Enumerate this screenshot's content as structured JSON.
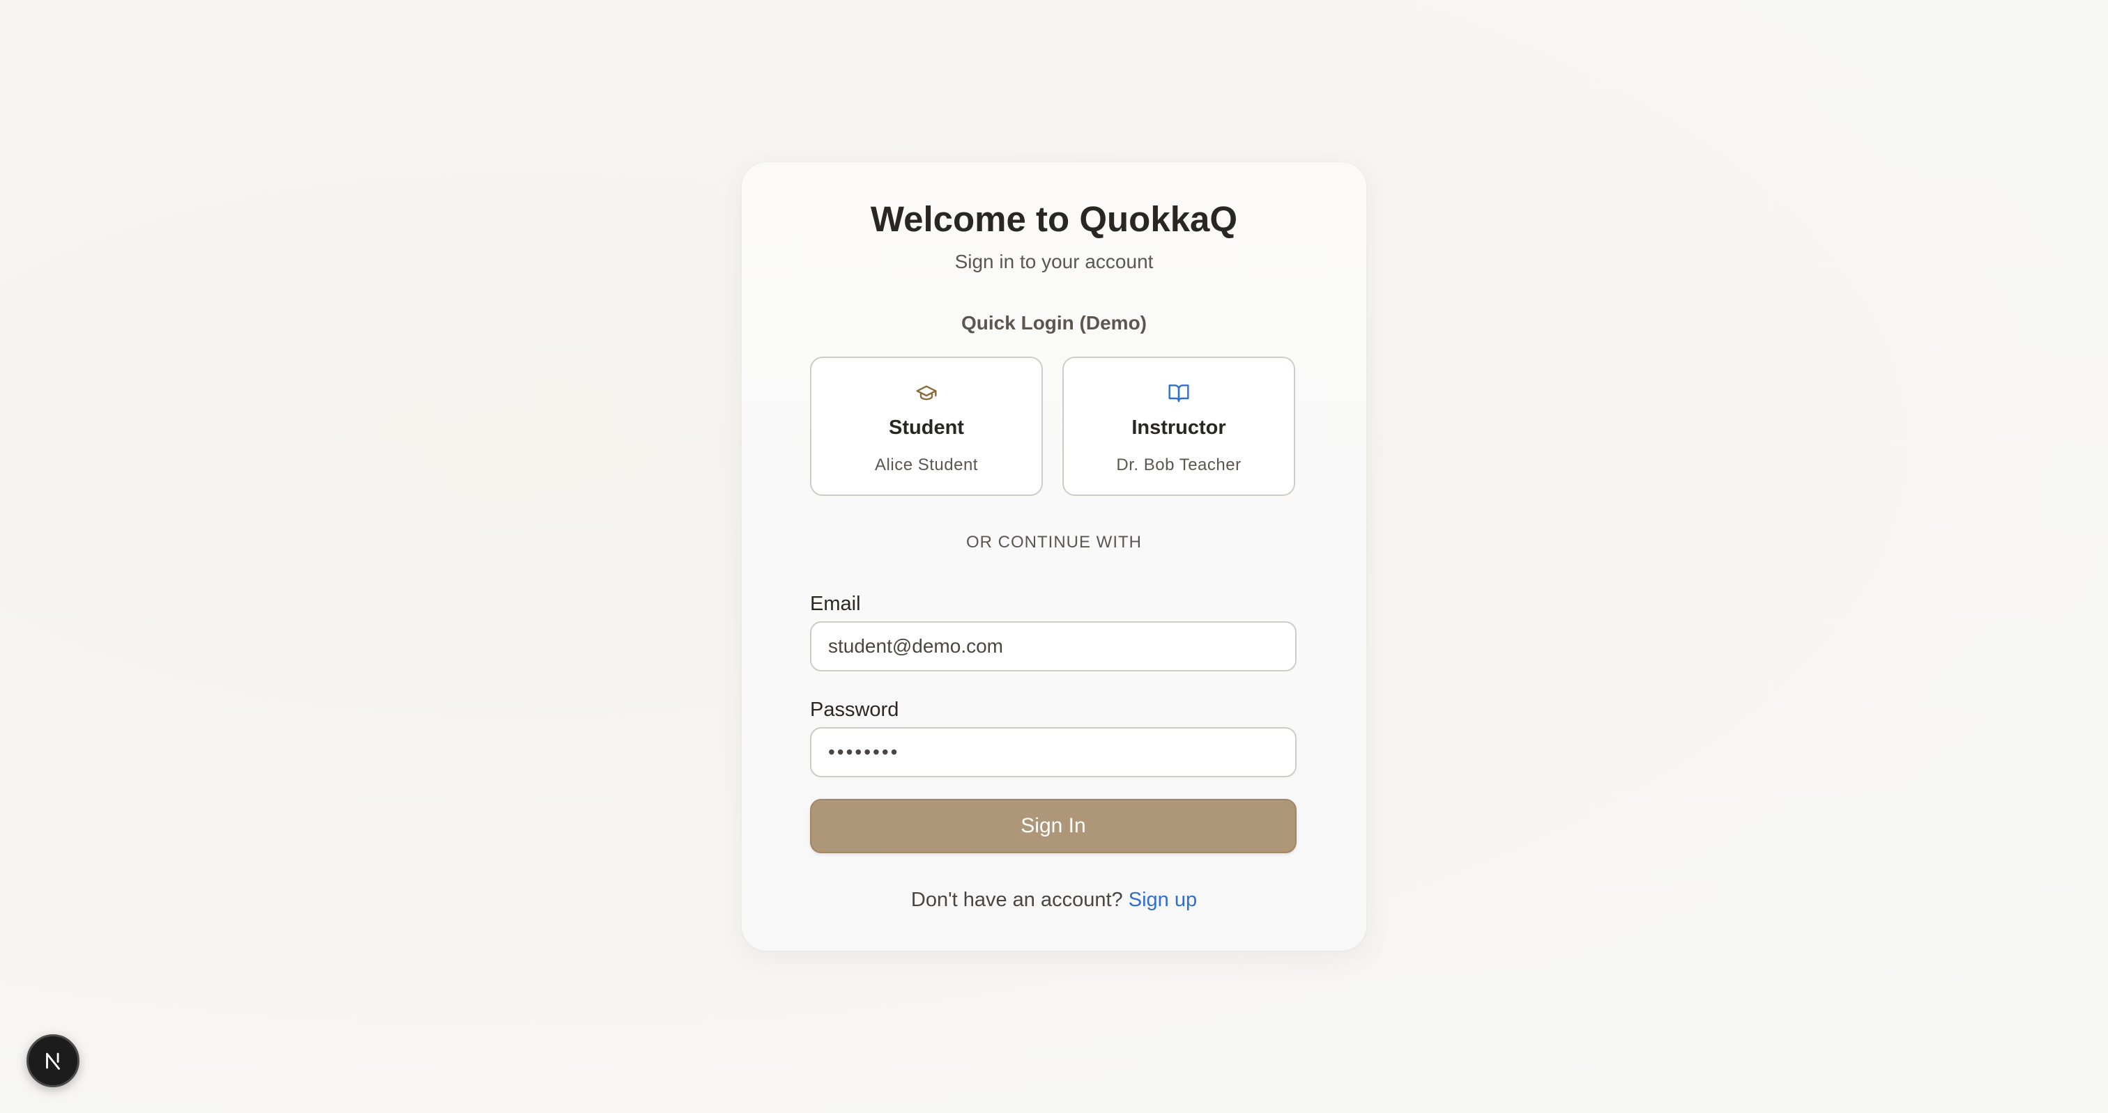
{
  "login": {
    "title": "Welcome to QuokkaQ",
    "subtitle": "Sign in to your account",
    "quick_login_heading": "Quick Login (Demo)",
    "roles": [
      {
        "title": "Student",
        "name": "Alice Student",
        "icon": "graduation-cap-icon",
        "icon_color": "#8b6b3d"
      },
      {
        "title": "Instructor",
        "name": "Dr. Bob Teacher",
        "icon": "open-book-icon",
        "icon_color": "#2f6fd0"
      }
    ],
    "divider_text": "OR CONTINUE WITH",
    "email_label": "Email",
    "email_value": "student@demo.com",
    "password_label": "Password",
    "password_value": "••••••••",
    "signin_label": "Sign In",
    "footer_text": "Don't have an account?",
    "signup_link": "Sign up"
  },
  "dev_badge": {
    "letter": "N"
  },
  "colors": {
    "accent": "#ae9678",
    "link": "#2f6fd0",
    "text": "#2a2622",
    "muted": "#5c5650"
  }
}
